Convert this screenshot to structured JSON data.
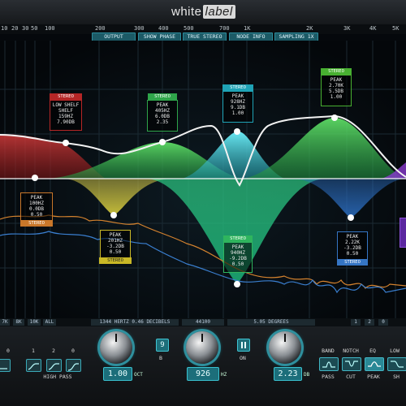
{
  "brand": {
    "name_plain": "white",
    "name_box": "label"
  },
  "top_scale": [
    "10",
    "20",
    "30",
    "50",
    "100",
    "200",
    "300",
    "400",
    "500",
    "700",
    "1K",
    "2K",
    "3K",
    "4K",
    "5K"
  ],
  "top_buttons": [
    "OUTPUT",
    "SHOW PHASE",
    "TRUE STEREO",
    "NODE INFO",
    "SAMPLING 1X"
  ],
  "nodes": [
    {
      "head": "STEREO",
      "lines": [
        "LOW SHELF",
        "SHELF",
        "159HZ",
        "7.90DB"
      ],
      "color": "#c43131",
      "head_pos": "top"
    },
    {
      "head": "STEREO",
      "lines": [
        "PEAK",
        "405HZ",
        "6.0DB",
        "2.35"
      ],
      "color": "#3cbf5b",
      "head_pos": "top"
    },
    {
      "head": "STEREO",
      "lines": [
        "PEAK",
        "928HZ",
        "9.1DB",
        "1.00"
      ],
      "color": "#2bb5c9",
      "head_pos": "top"
    },
    {
      "head": "STEREO",
      "lines": [
        "PEAK",
        "2.70K",
        "5.5DB",
        "1.00"
      ],
      "color": "#52c53c",
      "head_pos": "top"
    },
    {
      "head": "STEREO",
      "lines": [
        "PEAK",
        "100HZ",
        "0.0DB",
        "0.50"
      ],
      "color": "#d4822e",
      "head_pos": "bottom"
    },
    {
      "head": "STEREO",
      "lines": [
        "PEAK",
        "201HZ",
        "-3.2DB",
        "0.50"
      ],
      "color": "#d8c42a",
      "head_pos": "bottom"
    },
    {
      "head": "STEREO",
      "lines": [
        "PEAK",
        "940HZ",
        "-9.2DB",
        "0.50"
      ],
      "color": "#37c86a",
      "head_pos": "top"
    },
    {
      "head": "STEREO",
      "lines": [
        "PEAK",
        "2.22K",
        "-3.2DB",
        "0.50"
      ],
      "color": "#3a7fd0",
      "head_pos": "bottom"
    }
  ],
  "status_bar": {
    "left_ticks": [
      "7K",
      "8K",
      "10K",
      "ALL"
    ],
    "freq": "1344 HERTZ 0.46 DECIBELS",
    "rate": "44100",
    "phase": "5.05 DEGREES",
    "right_ticks": [
      "1",
      "2",
      "0"
    ]
  },
  "controls": {
    "left_nums": [
      "0",
      "1",
      "2",
      "0"
    ],
    "high_pass": "HIGH PASS",
    "oct_value": "1.00",
    "oct_unit": "OCT",
    "node_num": "9",
    "node_icon": "B",
    "freq_value": "926",
    "freq_unit": "HZ",
    "pause_label": "ON",
    "gain_value": "2.23",
    "gain_unit": "DB",
    "types": [
      "BAND",
      "NOTCH",
      "EQ",
      "LOW"
    ],
    "type_bottom": [
      "PASS",
      "CUT",
      "PEAK",
      "SH"
    ]
  },
  "colors": {
    "accent": "#2fa6b5",
    "bg": "#05080c",
    "lowshelf": "#c43131",
    "green": "#3cbf5b",
    "cyan": "#2bb5c9",
    "yellow": "#d8c42a",
    "blue": "#3a7fd0",
    "orange": "#d4822e"
  }
}
